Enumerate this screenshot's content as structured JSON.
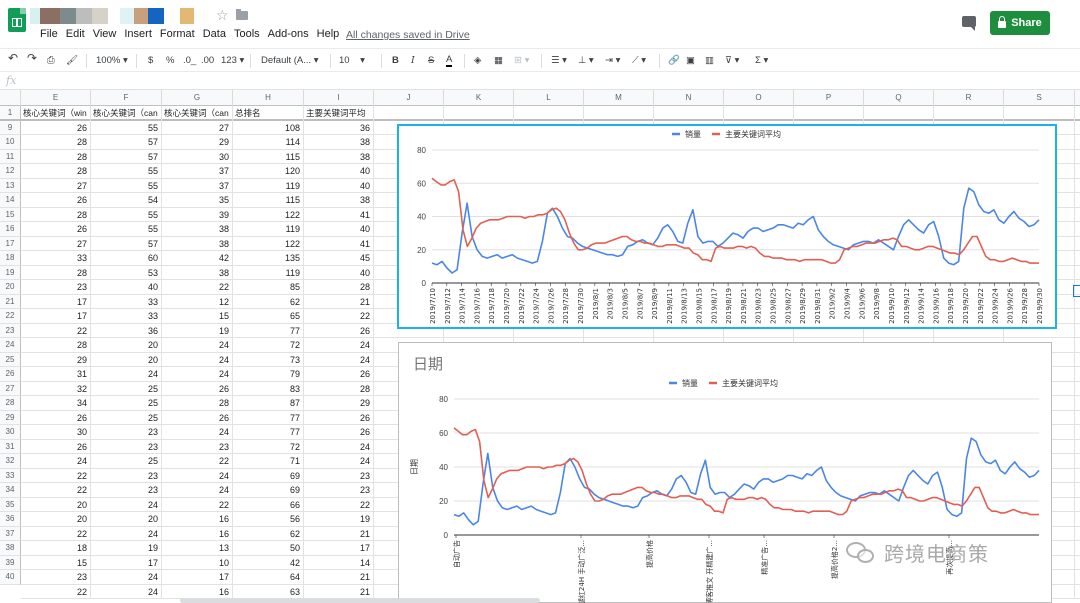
{
  "app": {
    "menu": [
      "File",
      "Edit",
      "View",
      "Insert",
      "Format",
      "Data",
      "Tools",
      "Add-ons",
      "Help"
    ],
    "saved_status": "All changes saved in Drive",
    "share_label": "Share",
    "title_blur_colors": [
      "#d8f0f0",
      "#8c6e63",
      "#7d8a8e",
      "#bdbdbd",
      "#d7d2c9",
      "#ffffff",
      "#dff3f6",
      "#c8a07e",
      "#1565c0",
      "#ffffff",
      "#e2b873"
    ]
  },
  "toolbar": {
    "zoom": "100%",
    "currency": "$",
    "percent": "%",
    "dec_less": ".0_",
    "dec_more": ".00",
    "number_format": "123",
    "font": "Default (A...",
    "font_size": "10",
    "bold": "B",
    "italic": "I",
    "strike": "S",
    "text_color": "A",
    "sigma": "Σ"
  },
  "formula": {
    "label": "fx"
  },
  "columns": [
    "E",
    "F",
    "G",
    "H",
    "I",
    "J",
    "K",
    "L",
    "M",
    "N",
    "O",
    "P",
    "Q",
    "R",
    "S"
  ],
  "row_numbers": [
    "1",
    "9",
    "10",
    "11",
    "12",
    "13",
    "14",
    "15",
    "16",
    "17",
    "18",
    "19",
    "20",
    "21",
    "22",
    "23",
    "24",
    "25",
    "26",
    "27",
    "28",
    "29",
    "30",
    "31",
    "32",
    "33",
    "34",
    "35",
    "36",
    "37",
    "38",
    "39",
    "40"
  ],
  "header_row": [
    "核心关键词（win",
    "核心关键词（can",
    "核心关键词（can",
    "总排名",
    "主要关键词平均"
  ],
  "rows": [
    [
      "26",
      "55",
      "27",
      "108",
      "36"
    ],
    [
      "28",
      "57",
      "29",
      "114",
      "38"
    ],
    [
      "28",
      "57",
      "30",
      "115",
      "38"
    ],
    [
      "28",
      "55",
      "37",
      "120",
      "40"
    ],
    [
      "27",
      "55",
      "37",
      "119",
      "40"
    ],
    [
      "26",
      "54",
      "35",
      "115",
      "38"
    ],
    [
      "28",
      "55",
      "39",
      "122",
      "41"
    ],
    [
      "26",
      "55",
      "38",
      "119",
      "40"
    ],
    [
      "27",
      "57",
      "38",
      "122",
      "41"
    ],
    [
      "33",
      "60",
      "42",
      "135",
      "45"
    ],
    [
      "28",
      "53",
      "38",
      "119",
      "40"
    ],
    [
      "23",
      "40",
      "22",
      "85",
      "28"
    ],
    [
      "17",
      "33",
      "12",
      "62",
      "21"
    ],
    [
      "17",
      "33",
      "15",
      "65",
      "22"
    ],
    [
      "22",
      "36",
      "19",
      "77",
      "26"
    ],
    [
      "28",
      "20",
      "24",
      "72",
      "24"
    ],
    [
      "29",
      "20",
      "24",
      "73",
      "24"
    ],
    [
      "31",
      "24",
      "24",
      "79",
      "26"
    ],
    [
      "32",
      "25",
      "26",
      "83",
      "28"
    ],
    [
      "34",
      "25",
      "28",
      "87",
      "29"
    ],
    [
      "26",
      "25",
      "26",
      "77",
      "26"
    ],
    [
      "30",
      "23",
      "24",
      "77",
      "26"
    ],
    [
      "26",
      "23",
      "23",
      "72",
      "24"
    ],
    [
      "24",
      "25",
      "22",
      "71",
      "24"
    ],
    [
      "22",
      "23",
      "24",
      "69",
      "23"
    ],
    [
      "22",
      "23",
      "24",
      "69",
      "23"
    ],
    [
      "20",
      "24",
      "22",
      "66",
      "22"
    ],
    [
      "20",
      "20",
      "16",
      "56",
      "19"
    ],
    [
      "22",
      "24",
      "16",
      "62",
      "21"
    ],
    [
      "18",
      "19",
      "13",
      "50",
      "17"
    ],
    [
      "15",
      "17",
      "10",
      "42",
      "14"
    ],
    [
      "23",
      "24",
      "17",
      "64",
      "21"
    ],
    [
      "22",
      "24",
      "16",
      "63",
      "21"
    ]
  ],
  "chart_data": [
    {
      "type": "line",
      "title": "",
      "legend_position": "top",
      "ylim": [
        0,
        80
      ],
      "yticks": [
        "0",
        "20",
        "40",
        "60",
        "80"
      ],
      "xtick_labels": [
        "2019/7/10",
        "2019/7/12",
        "2019/7/14",
        "2019/7/16",
        "2019/7/18",
        "2019/7/20",
        "2019/7/22",
        "2019/7/24",
        "2019/7/26",
        "2019/7/28",
        "2019/7/30",
        "2019/8/1",
        "2019/8/3",
        "2019/8/5",
        "2019/8/7",
        "2019/8/9",
        "2019/8/11",
        "2019/8/13",
        "2019/8/15",
        "2019/8/17",
        "2019/8/19",
        "2019/8/21",
        "2019/8/23",
        "2019/8/25",
        "2019/8/27",
        "2019/8/29",
        "2019/8/31",
        "2019/9/2",
        "2019/9/4",
        "2019/9/6",
        "2019/9/8",
        "2019/9/10",
        "2019/9/12",
        "2019/9/14",
        "2019/9/16",
        "2019/9/18",
        "2019/9/20",
        "2019/9/22",
        "2019/9/24",
        "2019/9/26",
        "2019/9/28",
        "2019/9/30"
      ],
      "series": [
        {
          "name": "销量",
          "color": "#4a86e8",
          "values": [
            12,
            11,
            13,
            9,
            6,
            8,
            30,
            48,
            28,
            20,
            16,
            15,
            16,
            17,
            15,
            16,
            17,
            15,
            14,
            13,
            12,
            13,
            25,
            42,
            45,
            40,
            33,
            28,
            27,
            24,
            22,
            21,
            20,
            19,
            18,
            17,
            17,
            16,
            17,
            22,
            23,
            25,
            26,
            24,
            23,
            27,
            33,
            35,
            31,
            25,
            24,
            36,
            44,
            28,
            24,
            25,
            25,
            22,
            24,
            27,
            30,
            29,
            27,
            31,
            33,
            33,
            31,
            32,
            33,
            35,
            35,
            34,
            33,
            36,
            35,
            38,
            40,
            32,
            28,
            25,
            23,
            22,
            21,
            20,
            23,
            24,
            25,
            25,
            24,
            26,
            24,
            22,
            20,
            28,
            35,
            38,
            35,
            32,
            30,
            35,
            37,
            28,
            15,
            12,
            11,
            13,
            45,
            57,
            55,
            47,
            43,
            42,
            44,
            38,
            36,
            40,
            43,
            39,
            37,
            34,
            35,
            38
          ]
        },
        {
          "name": "主要关键词平均",
          "color": "#e06055",
          "values": [
            63,
            61,
            59,
            59,
            61,
            62,
            55,
            32,
            22,
            27,
            33,
            36,
            37,
            38,
            38,
            38,
            39,
            40,
            40,
            40,
            40,
            39,
            40,
            40,
            41,
            41,
            42,
            44,
            45,
            43,
            38,
            30,
            24,
            20,
            20,
            21,
            23,
            24,
            24,
            24,
            25,
            26,
            27,
            28,
            28,
            26,
            25,
            25,
            24,
            24,
            23,
            22,
            22,
            23,
            23,
            23,
            22,
            21,
            21,
            18,
            17,
            14,
            14,
            13,
            21,
            22,
            21,
            21,
            21,
            22,
            22,
            21,
            22,
            21,
            18,
            16,
            16,
            15,
            15,
            15,
            14,
            14,
            14,
            13,
            14,
            14,
            14,
            14,
            14,
            13,
            12,
            12,
            14,
            20,
            21,
            22,
            22,
            23,
            24,
            24,
            24,
            25,
            26,
            26,
            27,
            26,
            22,
            22,
            21,
            20,
            20,
            21,
            22,
            22,
            21,
            20,
            19,
            18,
            18,
            17,
            20,
            24,
            28,
            28,
            22,
            16,
            14,
            14,
            13,
            13,
            14,
            15,
            14,
            13,
            13,
            12,
            12,
            12
          ]
        }
      ]
    },
    {
      "type": "line",
      "title": "日期",
      "ylabel": "日期",
      "legend_position": "top",
      "ylim": [
        0,
        80
      ],
      "yticks": [
        "0",
        "20",
        "40",
        "60",
        "80"
      ],
      "xtick_labels": [
        "自动广告",
        "aus 腿红24H 手动广泛...",
        "提高价格",
        "博客推文 开精建广...",
        "精准广告...",
        "提高价格2...",
        "再次提高..."
      ],
      "series": [
        {
          "name": "销量",
          "color": "#4a86e8",
          "values": [
            12,
            11,
            13,
            9,
            6,
            8,
            30,
            48,
            28,
            20,
            16,
            15,
            16,
            17,
            15,
            16,
            17,
            15,
            14,
            13,
            12,
            13,
            25,
            42,
            45,
            40,
            33,
            28,
            27,
            24,
            22,
            21,
            20,
            19,
            18,
            17,
            17,
            16,
            17,
            22,
            23,
            25,
            26,
            24,
            23,
            27,
            33,
            35,
            31,
            25,
            24,
            36,
            44,
            28,
            24,
            25,
            25,
            22,
            24,
            27,
            30,
            29,
            27,
            31,
            33,
            33,
            31,
            32,
            33,
            35,
            35,
            34,
            33,
            36,
            35,
            38,
            40,
            32,
            28,
            25,
            23,
            22,
            21,
            20,
            23,
            24,
            25,
            25,
            24,
            26,
            24,
            22,
            20,
            28,
            35,
            38,
            35,
            32,
            30,
            35,
            37,
            28,
            15,
            12,
            11,
            13,
            45,
            57,
            55,
            47,
            43,
            42,
            44,
            38,
            36,
            40,
            43,
            39,
            37,
            34,
            35,
            38
          ]
        },
        {
          "name": "主要关键词平均",
          "color": "#e06055",
          "values": [
            63,
            61,
            59,
            59,
            61,
            62,
            55,
            32,
            22,
            27,
            33,
            36,
            37,
            38,
            38,
            38,
            39,
            40,
            40,
            40,
            40,
            39,
            40,
            40,
            41,
            41,
            42,
            44,
            45,
            43,
            38,
            30,
            24,
            20,
            20,
            21,
            23,
            24,
            24,
            24,
            25,
            26,
            27,
            28,
            28,
            26,
            25,
            25,
            24,
            24,
            23,
            22,
            22,
            23,
            23,
            23,
            22,
            21,
            21,
            18,
            17,
            14,
            14,
            13,
            21,
            22,
            21,
            21,
            21,
            22,
            22,
            21,
            22,
            21,
            18,
            16,
            16,
            15,
            15,
            15,
            14,
            14,
            14,
            13,
            14,
            14,
            14,
            14,
            14,
            13,
            12,
            12,
            14,
            20,
            21,
            22,
            22,
            23,
            24,
            24,
            24,
            25,
            26,
            26,
            27,
            26,
            22,
            22,
            21,
            20,
            20,
            21,
            22,
            22,
            21,
            20,
            19,
            18,
            18,
            17,
            20,
            24,
            28,
            28,
            22,
            16,
            14,
            14,
            13,
            13,
            14,
            15,
            14,
            13,
            13,
            12,
            12,
            12
          ]
        }
      ]
    }
  ],
  "watermark": {
    "text": "跨境电商策"
  }
}
